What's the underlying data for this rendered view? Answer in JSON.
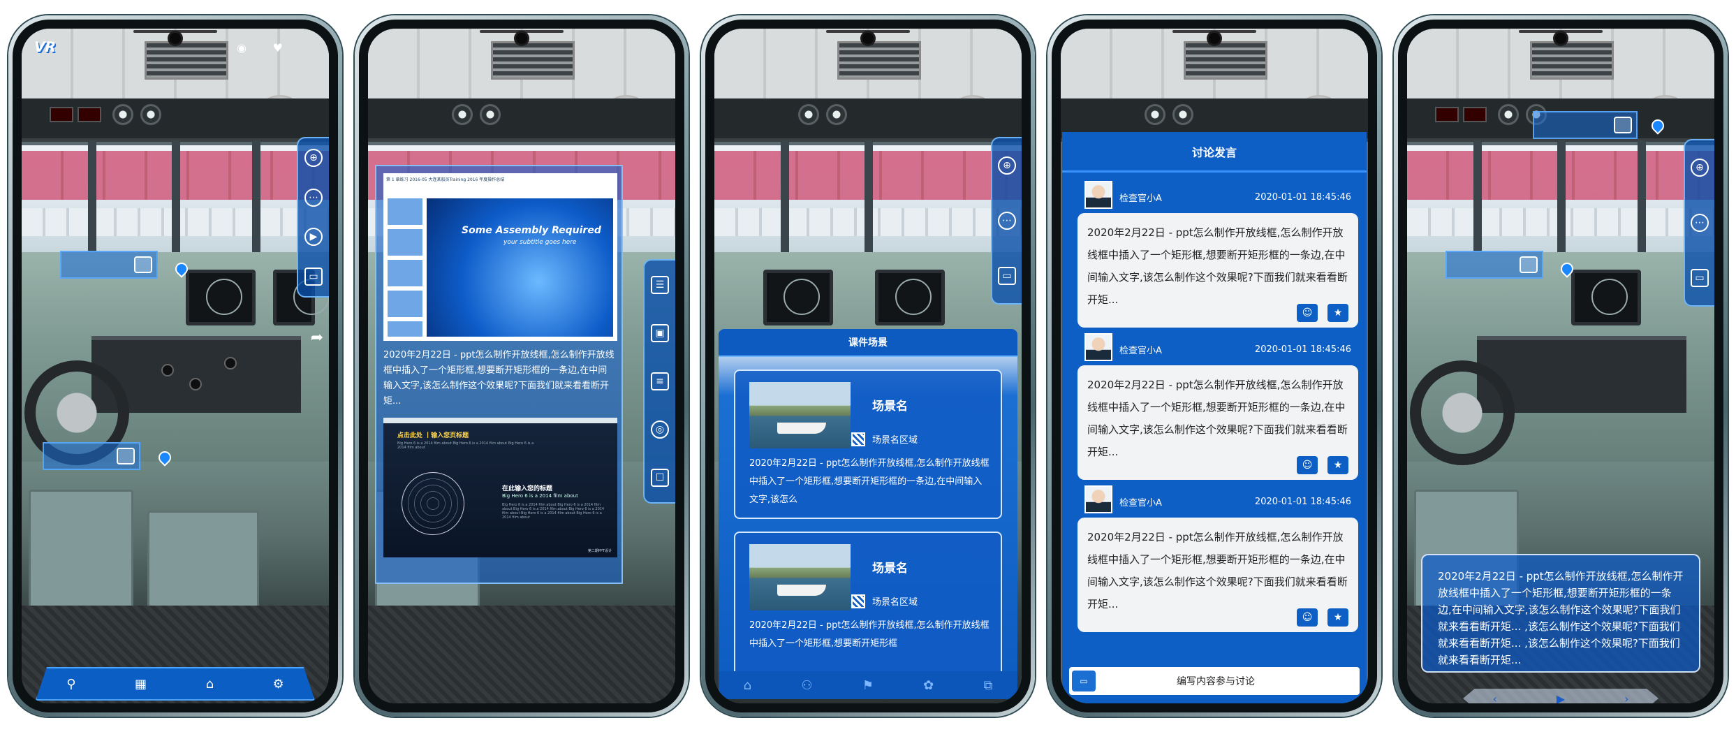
{
  "icons": {
    "vr_logo": "VR",
    "eye": "◉",
    "heart": "♥",
    "globe": "⊕",
    "more": "⋯",
    "play": "▶",
    "chat": "▭",
    "share": "➦",
    "document": "☰",
    "image": "▣",
    "list": "≡",
    "audio": "◎",
    "message": "☐",
    "emoji": "☺",
    "star": "★"
  },
  "screen1": {
    "nav": [
      "⚲",
      "▦",
      "⌂",
      "⚙"
    ]
  },
  "screen2": {
    "slide1_header": "第 1 章练习 2016-05  大连某船员Training 2016 年度操作总结",
    "slide1_title": "Some Assembly Required",
    "slide1_subtitle": "your subtitle goes here",
    "text": "2020年2月22日 - ppt怎么制作开放线框,怎么制作开放线框中插入了一个矩形框,想要断开矩形框的一条边,在中间输入文字,该怎么制作这个效果呢?下面我们就来看看断开矩...",
    "slide2_heading": "点击此处 丨输入您页标题",
    "slide2_subheading": "Big Hero 6 is a 2014 film about Big Hero 6 is a 2014 film about Big Hero 6 is a 2014 film about",
    "slide2_title": "在此输入您的标题",
    "slide2_line": "Big Hero 6 is a 2014 film about",
    "slide2_body": "Big Hero 6 is a 2014 film about Big Hero 6 is a 2014 film about Big Hero 6 is a 2014 film about Big Hero 6 is a 2014 film about Big Hero 6 is a 2014 film about Big Hero 6 is a 2014 film about",
    "slide2_footer": "第二期PPT设计"
  },
  "screen3": {
    "panel_title": "课件场景",
    "cards": [
      {
        "name": "场景名",
        "area": "场景名区域",
        "desc": "2020年2月22日 - ppt怎么制作开放线框,怎么制作开放线框中插入了一个矩形框,想要断开矩形框的一条边,在中间输入文字,该怎么"
      },
      {
        "name": "场景名",
        "area": "场景名区域",
        "desc": "2020年2月22日 - ppt怎么制作开放线框,怎么制作开放线框中插入了一个矩形框,想要断开矩形框"
      }
    ],
    "tabs": [
      "⌂",
      "⚇",
      "⚑",
      "✿",
      "⧉"
    ]
  },
  "screen4": {
    "title": "讨论发言",
    "posts": [
      {
        "user": "检查官小A",
        "time": "2020-01-01 18:45:46",
        "text": "2020年2月22日 - ppt怎么制作开放线框,怎么制作开放线框中插入了一个矩形框,想要断开矩形框的一条边,在中间输入文字,该怎么制作这个效果呢?下面我们就来看看断开矩..."
      },
      {
        "user": "检查官小A",
        "time": "2020-01-01 18:45:46",
        "text": "2020年2月22日 - ppt怎么制作开放线框,怎么制作开放线框中插入了一个矩形框,想要断开矩形框的一条边,在中间输入文字,该怎么制作这个效果呢?下面我们就来看看断开矩..."
      },
      {
        "user": "检查官小A",
        "time": "2020-01-01 18:45:46",
        "text": "2020年2月22日 - ppt怎么制作开放线框,怎么制作开放线框中插入了一个矩形框,想要断开矩形框的一条边,在中间输入文字,该怎么制作这个效果呢?下面我们就来看看断开矩..."
      }
    ],
    "compose_icon": "▭",
    "compose_label": "编写内容参与讨论"
  },
  "screen5": {
    "subtitle": "2020年2月22日 - ppt怎么制作开放线框,怎么制作开放线框中插入了一个矩形框,想要断开矩形框的一条边,在中间输入文字,该怎么制作这个效果呢?下面我们就来看看断开矩... ,该怎么制作这个效果呢?下面我们就来看看断开矩... ,该怎么制作这个效果呢?下面我们就来看看断开矩...",
    "prev": "‹",
    "play": "▶",
    "next": "›"
  }
}
